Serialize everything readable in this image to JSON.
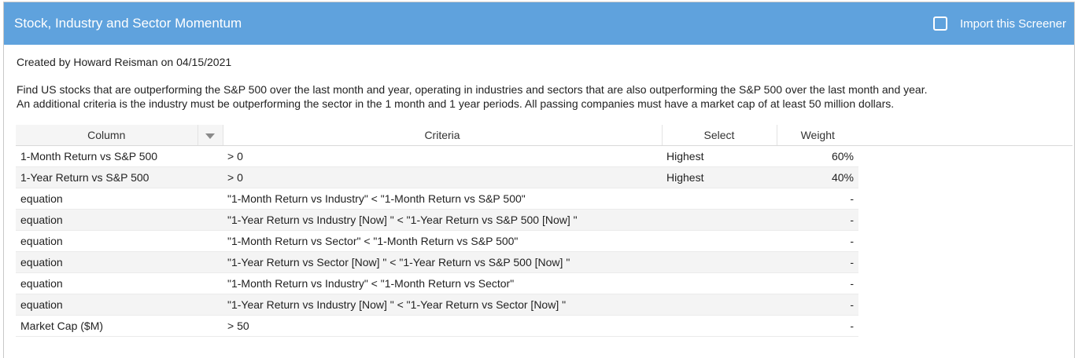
{
  "header": {
    "title": "Stock, Industry and Sector Momentum",
    "import_label": "Import this Screener",
    "import_checked": false
  },
  "meta": {
    "created": "Created by Howard Reisman on 04/15/2021"
  },
  "description": {
    "line1": "Find US stocks that are outperforming the S&P 500 over the last month and year, operating in industries and sectors that are also outperforming the S&P 500 over the last month and year.",
    "line2": "An additional criteria is the industry must be outperforming the sector in the 1 month and 1 year periods. All passing companies must have a market cap of at least 50 million dollars."
  },
  "table": {
    "headers": {
      "column": "Column",
      "criteria": "Criteria",
      "select": "Select",
      "weight": "Weight"
    },
    "rows": [
      {
        "column": "1-Month Return vs S&P 500",
        "criteria": "> 0",
        "select": "Highest",
        "weight": "60%"
      },
      {
        "column": "1-Year Return vs S&P 500",
        "criteria": "> 0",
        "select": "Highest",
        "weight": "40%"
      },
      {
        "column": "equation",
        "criteria": "\"1-Month Return vs Industry\" < \"1-Month Return vs S&P 500\"",
        "select": "",
        "weight": "-"
      },
      {
        "column": "equation",
        "criteria": "\"1-Year Return vs Industry [Now] \" < \"1-Year Return vs S&P 500 [Now] \"",
        "select": "",
        "weight": "-"
      },
      {
        "column": "equation",
        "criteria": "\"1-Month Return vs Sector\" < \"1-Month Return vs S&P 500\"",
        "select": "",
        "weight": "-"
      },
      {
        "column": "equation",
        "criteria": "\"1-Year Return vs Sector [Now] \" < \"1-Year Return vs S&P 500 [Now] \"",
        "select": "",
        "weight": "-"
      },
      {
        "column": "equation",
        "criteria": "\"1-Month Return vs Industry\" < \"1-Month Return vs Sector\"",
        "select": "",
        "weight": "-"
      },
      {
        "column": "equation",
        "criteria": "\"1-Year Return vs Industry [Now] \" < \"1-Year Return vs Sector [Now] \"",
        "select": "",
        "weight": "-"
      },
      {
        "column": "Market Cap ($M)",
        "criteria": "> 50",
        "select": "",
        "weight": "-"
      }
    ]
  },
  "colors": {
    "header_bg": "#5fa2dd",
    "header_text": "#ffffff",
    "row_alt": "#f4f4f4"
  },
  "icons": {
    "import_checkbox": "checkbox-empty-icon",
    "column_sort": "caret-down-icon"
  }
}
